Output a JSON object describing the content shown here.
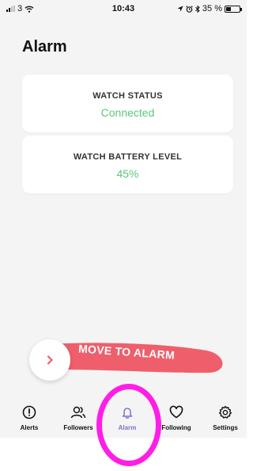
{
  "status_bar": {
    "carrier": "3",
    "time": "10:43",
    "battery_percent": "35 %",
    "battery_level": 0.35
  },
  "page": {
    "title": "Alarm"
  },
  "cards": {
    "status": {
      "label": "WATCH STATUS",
      "value": "Connected",
      "value_color": "#5cc77a"
    },
    "battery": {
      "label": "WATCH BATTERY LEVEL",
      "value": "45%",
      "value_color": "#5cc77a"
    }
  },
  "slider": {
    "label": "MOVE TO ALARM",
    "track_color": "#ef5f6b",
    "knob_icon": "chevron-right-icon"
  },
  "tab_bar": {
    "active": "alarm",
    "accent_color": "#7a73c9",
    "items": [
      {
        "label": "Alerts",
        "icon": "alert-circle-icon"
      },
      {
        "label": "Followers",
        "icon": "users-icon"
      },
      {
        "label": "Alarm",
        "icon": "bell-icon"
      },
      {
        "label": "Following",
        "icon": "heart-icon"
      },
      {
        "label": "Settings",
        "icon": "gear-icon"
      }
    ]
  },
  "annotation": {
    "ring_color": "#ff1ee6"
  }
}
